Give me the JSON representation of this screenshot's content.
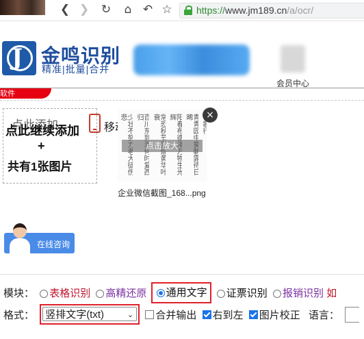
{
  "browser": {
    "url_scheme": "https://",
    "url_host": "www.jm189.cn",
    "url_path": "/a/ocr/"
  },
  "header": {
    "logo_title": "金鸣识别",
    "logo_subtitle": "精准|批量|合并",
    "member_center": "会员中心",
    "red_tab_text": "软件"
  },
  "upload": {
    "add_ghost": "点此添加",
    "add_line1": "点此继续添加",
    "plus": "+",
    "count_text": "共有1张图片",
    "mobile_label": "移动端",
    "zoom_text": "点击放大",
    "close_symbol": "×",
    "file_name": "企业微信截图_168...png",
    "thumb_columns": [
      "长歌行",
      "青青园中葵朝露待日晞",
      "阳春布德泽万物生光辉",
      "常恐秋节至焜黄华叶衰",
      "百川东到海何时复西归",
      "少壮不努力老大徒伤悲"
    ]
  },
  "consult": {
    "label": "在线咨询"
  },
  "mode": {
    "label": "模块：",
    "options": [
      {
        "label": "表格识别",
        "selected": false
      },
      {
        "label": "高精还原",
        "selected": false
      },
      {
        "label": "通用文字",
        "selected": true
      },
      {
        "label": "证票识别",
        "selected": false
      },
      {
        "label": "报销识别",
        "selected": false
      }
    ],
    "overflow_char": "如"
  },
  "format": {
    "label": "格式：",
    "selected_value": "竖排文字(txt)",
    "merge_label": "合并输出",
    "merge_checked": false,
    "rtl_label": "右到左",
    "rtl_checked": true,
    "correct_label": "图片校正",
    "correct_checked": true,
    "language_label": "语言："
  }
}
